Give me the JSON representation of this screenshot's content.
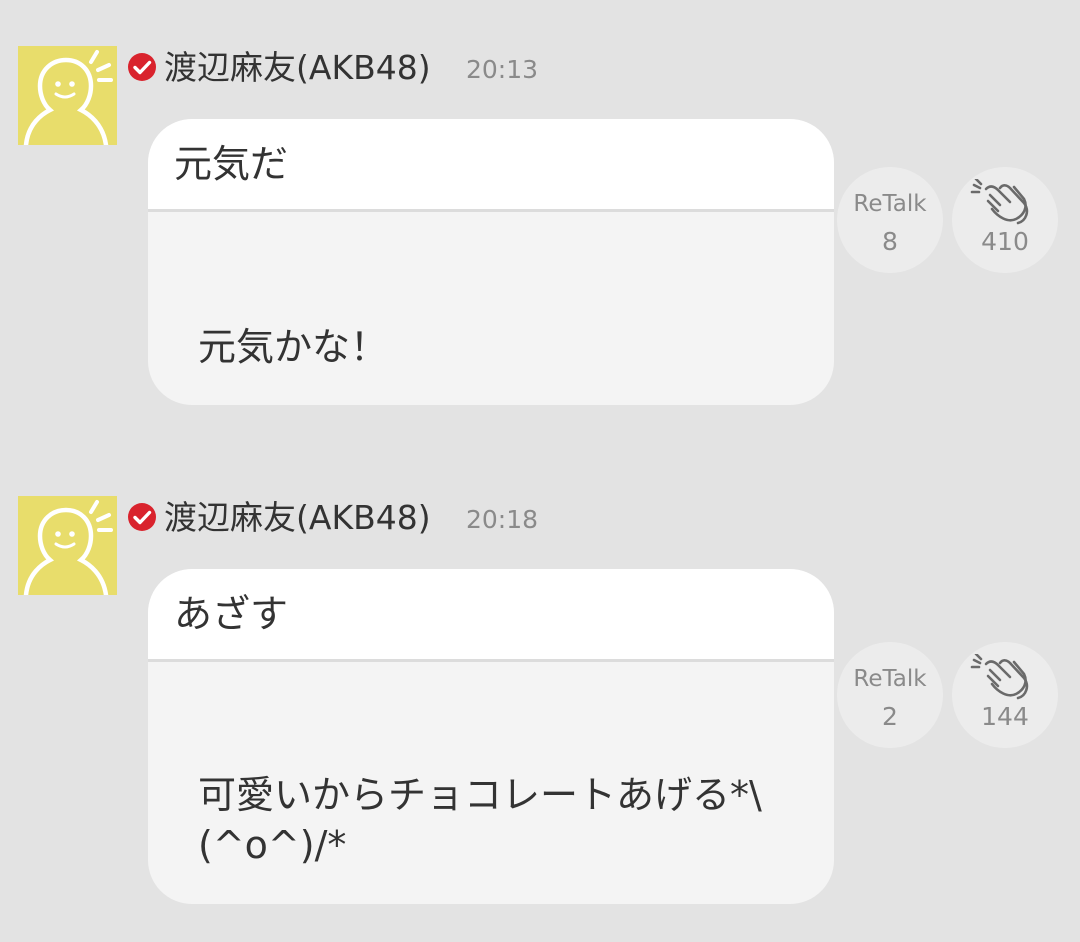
{
  "colors": {
    "background": "#e3e3e3",
    "bubble_header": "#ffffff",
    "bubble_body": "#f4f4f4",
    "avatar_yellow": "#e8dd6b",
    "verified_red": "#d9232d",
    "muted_text": "#8a8a8a"
  },
  "icons": {
    "avatar": "avatar-figure-icon",
    "verified": "verified-check-icon",
    "clap": "clapping-hands-icon"
  },
  "posts": [
    {
      "author": "渡辺麻友(AKB48)",
      "time": "20:13",
      "title": "元気だ",
      "body": "元気かな！",
      "retalk_label": "ReTalk",
      "retalk_count": "8",
      "clap_count": "410"
    },
    {
      "author": "渡辺麻友(AKB48)",
      "time": "20:18",
      "title": "あざす",
      "body": "可愛いからチョコレートあげる*\\(^o^)/*",
      "retalk_label": "ReTalk",
      "retalk_count": "2",
      "clap_count": "144"
    }
  ]
}
